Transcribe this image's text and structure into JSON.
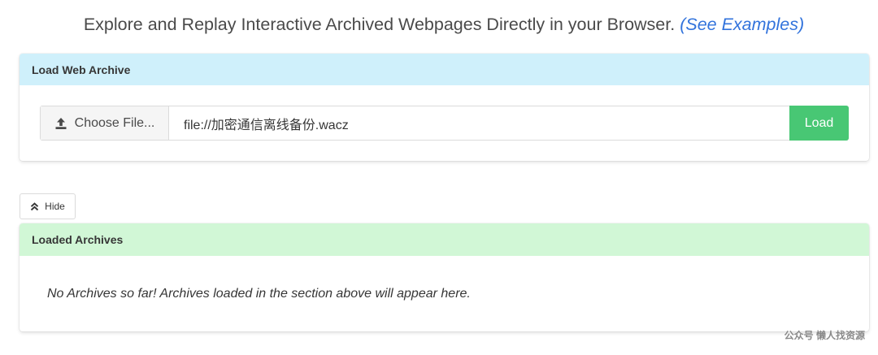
{
  "intro": {
    "text": "Explore and Replay Interactive Archived Webpages Directly in your Browser.",
    "link_label": "(See Examples)"
  },
  "load_card": {
    "title": "Load Web Archive",
    "choose_file_label": "Choose File...",
    "url_value": "file://加密通信离线备份.wacz",
    "load_label": "Load"
  },
  "hide_button": {
    "label": "Hide"
  },
  "loaded_card": {
    "title": "Loaded Archives",
    "empty_message": "No Archives so far! Archives loaded in the section above will appear here."
  },
  "watermark": "公众号 懒人找资源",
  "icons": {
    "upload": "upload-icon",
    "hide": "double-chevron-up-icon"
  },
  "colors": {
    "link": "#3273dc",
    "load_header": "#cff0fb",
    "loaded_header": "#d1f7d6",
    "load_button": "#48c774"
  }
}
